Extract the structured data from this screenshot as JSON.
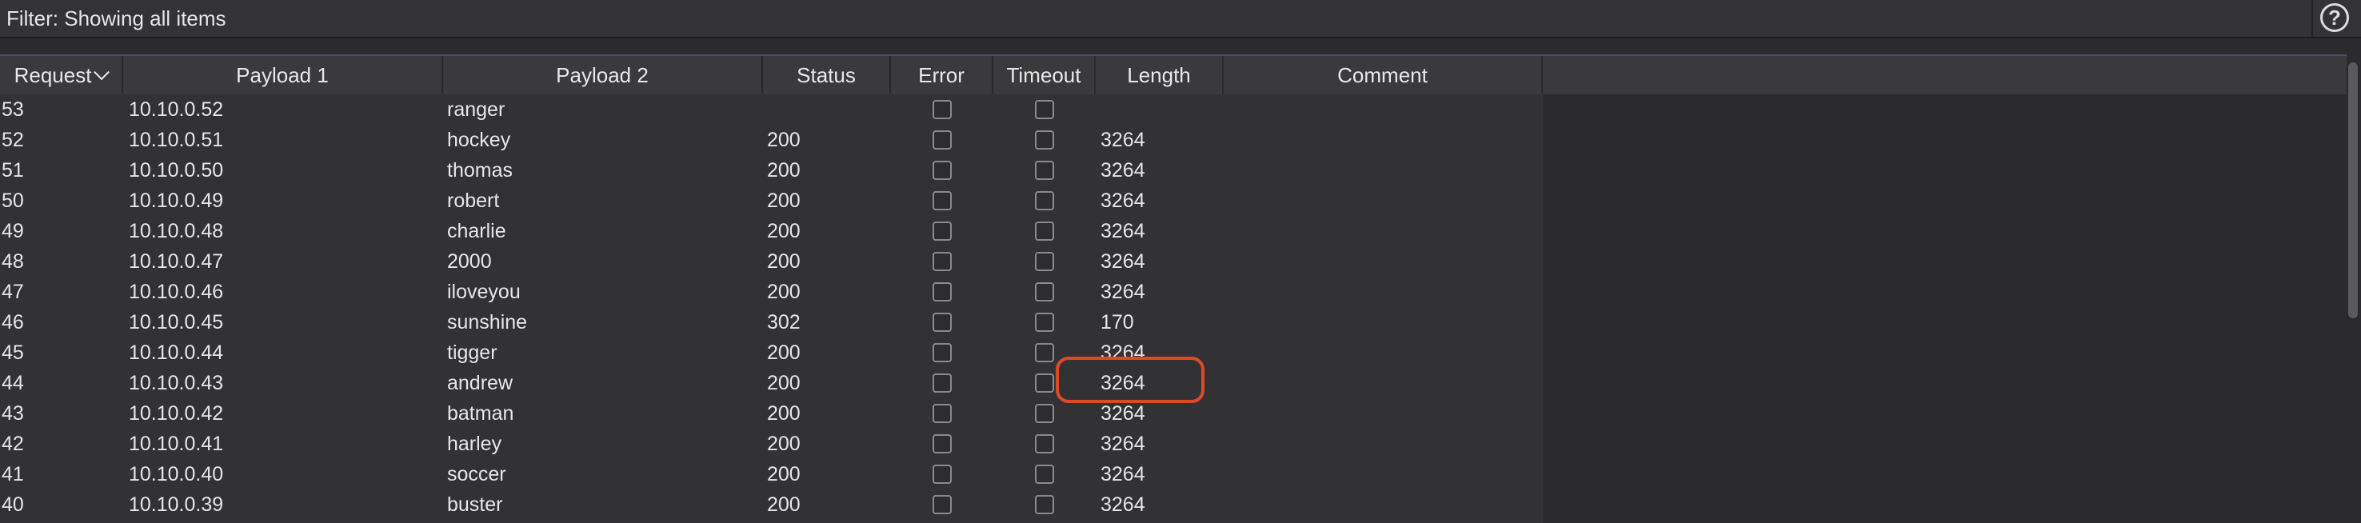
{
  "filter": {
    "text": "Filter: Showing all items",
    "help_glyph": "?"
  },
  "columns": [
    {
      "key": "request",
      "label": "Request",
      "sorted": "descending"
    },
    {
      "key": "payload1",
      "label": "Payload 1"
    },
    {
      "key": "payload2",
      "label": "Payload 2"
    },
    {
      "key": "status",
      "label": "Status"
    },
    {
      "key": "error",
      "label": "Error"
    },
    {
      "key": "timeout",
      "label": "Timeout"
    },
    {
      "key": "length",
      "label": "Length"
    },
    {
      "key": "comment",
      "label": "Comment"
    }
  ],
  "rows": [
    {
      "request": "53",
      "payload1": "10.10.0.52",
      "payload2": "ranger",
      "status": "",
      "error": false,
      "timeout": false,
      "length": "",
      "comment": ""
    },
    {
      "request": "52",
      "payload1": "10.10.0.51",
      "payload2": "hockey",
      "status": "200",
      "error": false,
      "timeout": false,
      "length": "3264",
      "comment": ""
    },
    {
      "request": "51",
      "payload1": "10.10.0.50",
      "payload2": "thomas",
      "status": "200",
      "error": false,
      "timeout": false,
      "length": "3264",
      "comment": ""
    },
    {
      "request": "50",
      "payload1": "10.10.0.49",
      "payload2": "robert",
      "status": "200",
      "error": false,
      "timeout": false,
      "length": "3264",
      "comment": ""
    },
    {
      "request": "49",
      "payload1": "10.10.0.48",
      "payload2": "charlie",
      "status": "200",
      "error": false,
      "timeout": false,
      "length": "3264",
      "comment": ""
    },
    {
      "request": "48",
      "payload1": "10.10.0.47",
      "payload2": "2000",
      "status": "200",
      "error": false,
      "timeout": false,
      "length": "3264",
      "comment": ""
    },
    {
      "request": "47",
      "payload1": "10.10.0.46",
      "payload2": "iloveyou",
      "status": "200",
      "error": false,
      "timeout": false,
      "length": "3264",
      "comment": ""
    },
    {
      "request": "46",
      "payload1": "10.10.0.45",
      "payload2": "sunshine",
      "status": "302",
      "error": false,
      "timeout": false,
      "length": "170",
      "comment": "",
      "highlighted": true
    },
    {
      "request": "45",
      "payload1": "10.10.0.44",
      "payload2": "tigger",
      "status": "200",
      "error": false,
      "timeout": false,
      "length": "3264",
      "comment": ""
    },
    {
      "request": "44",
      "payload1": "10.10.0.43",
      "payload2": "andrew",
      "status": "200",
      "error": false,
      "timeout": false,
      "length": "3264",
      "comment": ""
    },
    {
      "request": "43",
      "payload1": "10.10.0.42",
      "payload2": "batman",
      "status": "200",
      "error": false,
      "timeout": false,
      "length": "3264",
      "comment": ""
    },
    {
      "request": "42",
      "payload1": "10.10.0.41",
      "payload2": "harley",
      "status": "200",
      "error": false,
      "timeout": false,
      "length": "3264",
      "comment": ""
    },
    {
      "request": "41",
      "payload1": "10.10.0.40",
      "payload2": "soccer",
      "status": "200",
      "error": false,
      "timeout": false,
      "length": "3264",
      "comment": ""
    },
    {
      "request": "40",
      "payload1": "10.10.0.39",
      "payload2": "buster",
      "status": "200",
      "error": false,
      "timeout": false,
      "length": "3264",
      "comment": ""
    }
  ],
  "colors": {
    "highlight": "#e0482a",
    "header_bg": "#3a3a3c",
    "row_bg": "#323234"
  },
  "icons": {
    "help": "help-circle-icon",
    "sort": "chevron-down-icon"
  }
}
